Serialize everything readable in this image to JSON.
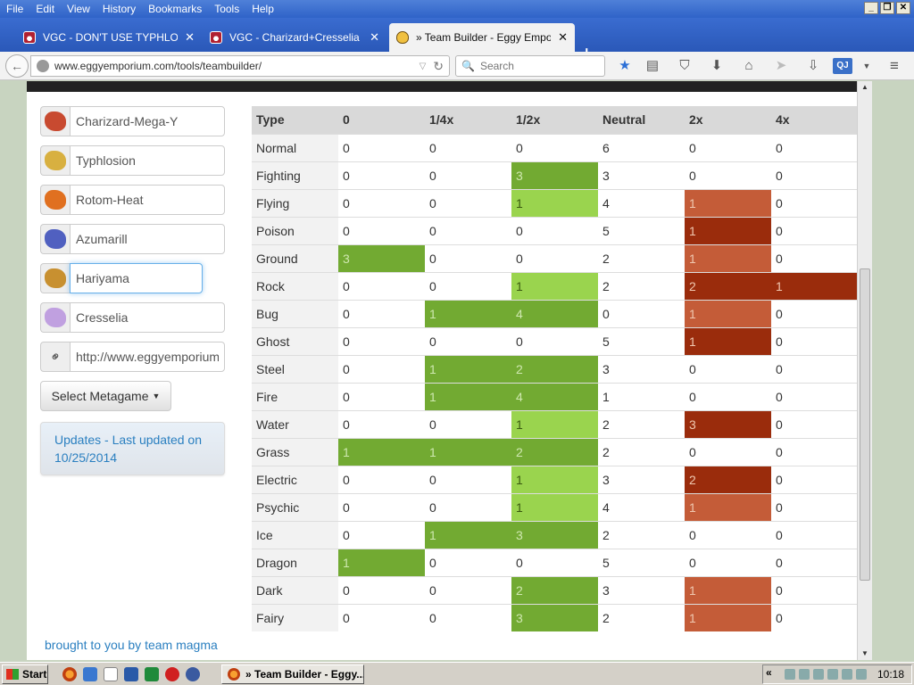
{
  "menubar": {
    "items": [
      "File",
      "Edit",
      "View",
      "History",
      "Bookmarks",
      "Tools",
      "Help"
    ]
  },
  "tabs": [
    {
      "title": "VGC - DON'T USE TYPHLOSIO...",
      "icon": "pokeball-icon"
    },
    {
      "title": "VGC - Charizard+Cresselia Su...",
      "icon": "pokeball-icon"
    },
    {
      "title": "» Team Builder - Eggy Emporium",
      "icon": "egg-icon",
      "active": true
    }
  ],
  "nav": {
    "url": "www.eggyemporium.com/tools/teambuilder/",
    "search_placeholder": "Search",
    "qj_label": "QJ"
  },
  "team": [
    {
      "name": "Charizard-Mega-Y",
      "sprite_color": "#c84a30"
    },
    {
      "name": "Typhlosion",
      "sprite_color": "#d8b040"
    },
    {
      "name": "Rotom-Heat",
      "sprite_color": "#e07020"
    },
    {
      "name": "Azumarill",
      "sprite_color": "#5060c0"
    },
    {
      "name": "Hariyama",
      "sprite_color": "#c89030"
    },
    {
      "name": "Cresselia",
      "sprite_color": "#c0a0e0"
    }
  ],
  "share_url": "http://www.eggyemporium.com",
  "metagame_button": "Select Metagame",
  "updates": "Updates - Last updated on 10/25/2014",
  "footer_link": "brought to you by team magma",
  "table": {
    "headers": [
      "Type",
      "0",
      "1/4x",
      "1/2x",
      "Neutral",
      "2x",
      "4x"
    ],
    "rows": [
      {
        "type": "Normal",
        "v": [
          "0",
          "0",
          "0",
          "6",
          "0",
          "0"
        ],
        "c": [
          "",
          "",
          "",
          "",
          "",
          ""
        ]
      },
      {
        "type": "Fighting",
        "v": [
          "0",
          "0",
          "3",
          "3",
          "0",
          "0"
        ],
        "c": [
          "",
          "",
          "g1",
          "",
          "",
          ""
        ]
      },
      {
        "type": "Flying",
        "v": [
          "0",
          "0",
          "1",
          "4",
          "1",
          "0"
        ],
        "c": [
          "",
          "",
          "g2",
          "",
          "o1",
          ""
        ]
      },
      {
        "type": "Poison",
        "v": [
          "0",
          "0",
          "0",
          "5",
          "1",
          "0"
        ],
        "c": [
          "",
          "",
          "",
          "",
          "r1",
          ""
        ]
      },
      {
        "type": "Ground",
        "v": [
          "3",
          "0",
          "0",
          "2",
          "1",
          "0"
        ],
        "c": [
          "g1",
          "",
          "",
          "",
          "o1",
          ""
        ]
      },
      {
        "type": "Rock",
        "v": [
          "0",
          "0",
          "1",
          "2",
          "2",
          "1"
        ],
        "c": [
          "",
          "",
          "g2",
          "",
          "r1",
          "r1"
        ]
      },
      {
        "type": "Bug",
        "v": [
          "0",
          "1",
          "4",
          "0",
          "1",
          "0"
        ],
        "c": [
          "",
          "g1",
          "g1",
          "",
          "o1",
          ""
        ]
      },
      {
        "type": "Ghost",
        "v": [
          "0",
          "0",
          "0",
          "5",
          "1",
          "0"
        ],
        "c": [
          "",
          "",
          "",
          "",
          "r1",
          ""
        ]
      },
      {
        "type": "Steel",
        "v": [
          "0",
          "1",
          "2",
          "3",
          "0",
          "0"
        ],
        "c": [
          "",
          "g1",
          "g1",
          "",
          "",
          ""
        ]
      },
      {
        "type": "Fire",
        "v": [
          "0",
          "1",
          "4",
          "1",
          "0",
          "0"
        ],
        "c": [
          "",
          "g1",
          "g1",
          "",
          "",
          ""
        ]
      },
      {
        "type": "Water",
        "v": [
          "0",
          "0",
          "1",
          "2",
          "3",
          "0"
        ],
        "c": [
          "",
          "",
          "g2",
          "",
          "r1",
          ""
        ]
      },
      {
        "type": "Grass",
        "v": [
          "1",
          "1",
          "2",
          "2",
          "0",
          "0"
        ],
        "c": [
          "g1",
          "g1",
          "g1",
          "",
          "",
          ""
        ]
      },
      {
        "type": "Electric",
        "v": [
          "0",
          "0",
          "1",
          "3",
          "2",
          "0"
        ],
        "c": [
          "",
          "",
          "g2",
          "",
          "r1",
          ""
        ]
      },
      {
        "type": "Psychic",
        "v": [
          "0",
          "0",
          "1",
          "4",
          "1",
          "0"
        ],
        "c": [
          "",
          "",
          "g2",
          "",
          "o1",
          ""
        ]
      },
      {
        "type": "Ice",
        "v": [
          "0",
          "1",
          "3",
          "2",
          "0",
          "0"
        ],
        "c": [
          "",
          "g1",
          "g1",
          "",
          "",
          ""
        ]
      },
      {
        "type": "Dragon",
        "v": [
          "1",
          "0",
          "0",
          "5",
          "0",
          "0"
        ],
        "c": [
          "g1",
          "",
          "",
          "",
          "",
          ""
        ]
      },
      {
        "type": "Dark",
        "v": [
          "0",
          "0",
          "2",
          "3",
          "1",
          "0"
        ],
        "c": [
          "",
          "",
          "g1",
          "",
          "o1",
          ""
        ]
      },
      {
        "type": "Fairy",
        "v": [
          "0",
          "0",
          "3",
          "2",
          "1",
          "0"
        ],
        "c": [
          "",
          "",
          "g1",
          "",
          "o1",
          ""
        ]
      }
    ]
  },
  "taskbar": {
    "start_label": "Start",
    "task_title": "» Team Builder - Eggy...",
    "clock": "10:18"
  }
}
